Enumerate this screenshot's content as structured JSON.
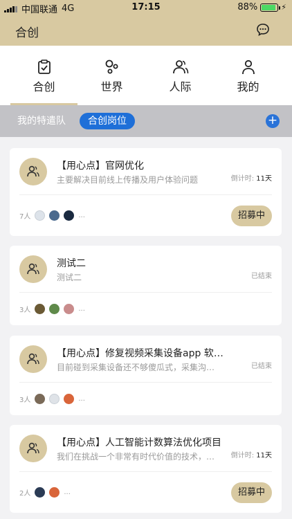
{
  "status_bar": {
    "carrier": "中国联通",
    "network": "4G",
    "time": "17:15",
    "battery_pct": "88%"
  },
  "nav": {
    "title": "合创",
    "message_icon": "chat-bubble-icon"
  },
  "tabs": [
    {
      "label": "合创",
      "icon": "clipboard-check-icon",
      "active": true
    },
    {
      "label": "世界",
      "icon": "world-icon",
      "active": false
    },
    {
      "label": "人际",
      "icon": "people-icon",
      "active": false
    },
    {
      "label": "我的",
      "icon": "person-icon",
      "active": false
    }
  ],
  "filter": {
    "item1": "我的特遣队",
    "active": "合创岗位",
    "add_icon": "plus-icon"
  },
  "colors": {
    "accent": "#d8c9a1",
    "blue": "#1e6fd8"
  },
  "cards": [
    {
      "title": "【用心点】官网优化",
      "subtitle": "主要解决目前线上传播及用户体验问题",
      "status_prefix": "倒计时:",
      "status_days": "11天",
      "members": "7人",
      "more": "...",
      "button": "招募中"
    },
    {
      "title": "测试二",
      "subtitle": "测试二",
      "status_prefix": "已结束",
      "status_days": "",
      "members": "3人",
      "more": "...",
      "button": ""
    },
    {
      "title": "【用心点】修复视频采集设备app 软件功能",
      "subtitle": "目前碰到采集设备还不够傻瓜式，采集沟通效率低",
      "status_prefix": "已结束",
      "status_days": "",
      "members": "3人",
      "more": "...",
      "button": ""
    },
    {
      "title": "【用心点】人工智能计数算法优化项目",
      "subtitle": "我们在挑战一个非常有时代价值的技术，欢迎加入",
      "status_prefix": "倒计时:",
      "status_days": "11天",
      "members": "2人",
      "more": "...",
      "button": "招募中"
    }
  ]
}
